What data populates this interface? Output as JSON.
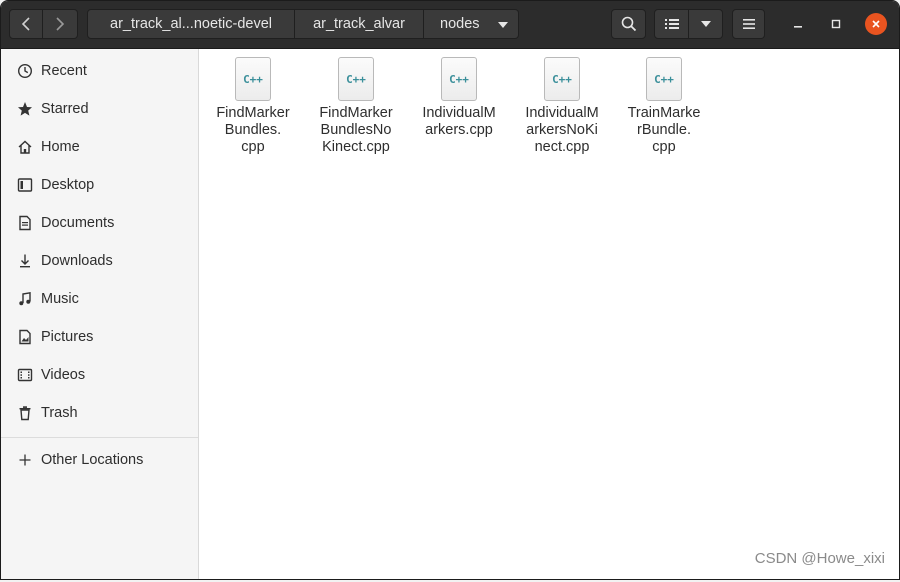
{
  "navigation": {
    "back_icon": "chevron-left-icon",
    "forward_icon": "chevron-right-icon"
  },
  "breadcrumb": [
    {
      "label": "ar_track_al...noetic-devel"
    },
    {
      "label": "ar_track_alvar"
    },
    {
      "label": "nodes"
    }
  ],
  "sidebar": {
    "items": [
      {
        "label": "Recent",
        "icon": "clock-icon"
      },
      {
        "label": "Starred",
        "icon": "star-icon"
      },
      {
        "label": "Home",
        "icon": "home-icon"
      },
      {
        "label": "Desktop",
        "icon": "desktop-icon"
      },
      {
        "label": "Documents",
        "icon": "document-icon"
      },
      {
        "label": "Downloads",
        "icon": "download-icon"
      },
      {
        "label": "Music",
        "icon": "music-icon"
      },
      {
        "label": "Pictures",
        "icon": "picture-icon"
      },
      {
        "label": "Videos",
        "icon": "video-icon"
      },
      {
        "label": "Trash",
        "icon": "trash-icon"
      }
    ],
    "other_locations": {
      "label": "Other Locations",
      "icon": "plus-icon"
    }
  },
  "files": [
    {
      "name": "FindMarker\nBundles.\ncpp",
      "badge": "C++"
    },
    {
      "name": "FindMarker\nBundlesNo\nKinect.cpp",
      "badge": "C++"
    },
    {
      "name": "IndividualM\narkers.cpp",
      "badge": "C++"
    },
    {
      "name": "IndividualM\narkersNoKi\nnect.cpp",
      "badge": "C++"
    },
    {
      "name": "TrainMarke\nrBundle.\ncpp",
      "badge": "C++"
    }
  ],
  "watermark": "CSDN @Howe_xixi",
  "colors": {
    "headerbar": "#2c2c2c",
    "close_button": "#e95420",
    "file_badge": "#3a8f9a"
  }
}
